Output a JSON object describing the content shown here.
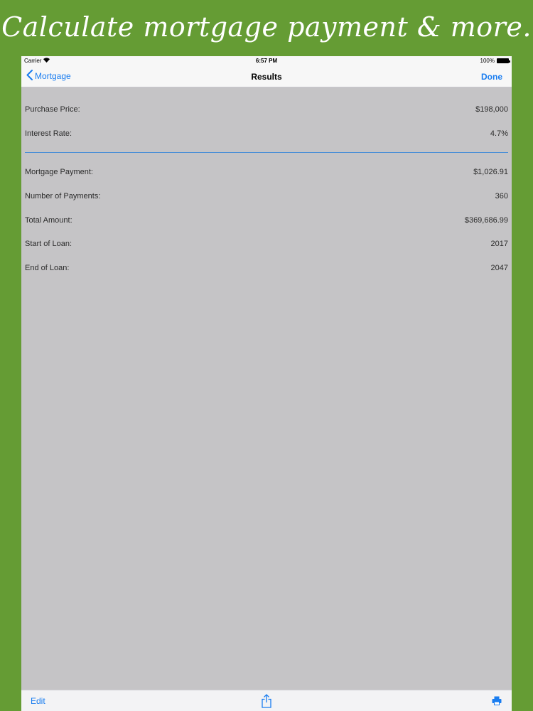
{
  "banner": {
    "text": "Calculate mortgage payment & more."
  },
  "status_bar": {
    "carrier": "Carrier",
    "time": "6:57 PM",
    "battery": "100%"
  },
  "nav": {
    "back_label": "Mortgage",
    "title": "Results",
    "done_label": "Done"
  },
  "inputs": [
    {
      "label": "Purchase Price:",
      "value": "$198,000"
    },
    {
      "label": "Interest Rate:",
      "value": "4.7%"
    }
  ],
  "results": [
    {
      "label": "Mortgage Payment:",
      "value": "$1,026.91"
    },
    {
      "label": "Number of Payments:",
      "value": "360"
    },
    {
      "label": "Total Amount:",
      "value": "$369,686.99"
    },
    {
      "label": "Start of Loan:",
      "value": "2017"
    },
    {
      "label": "End of Loan:",
      "value": "2047"
    }
  ],
  "toolbar": {
    "edit_label": "Edit",
    "share_icon": "share-icon",
    "print_icon": "printer-icon"
  },
  "colors": {
    "background": "#659c34",
    "accent": "#1a7df0",
    "content_bg": "#c5c4c6",
    "divider": "#4b8fd6"
  }
}
